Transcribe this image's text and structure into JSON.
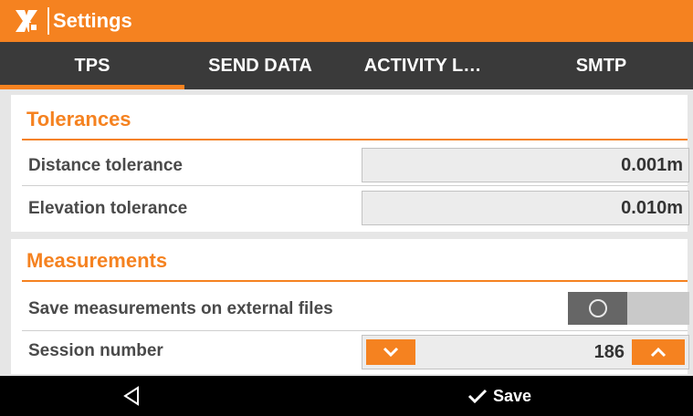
{
  "app": {
    "title": "Settings",
    "icon": "app-logo-icon"
  },
  "tabs": [
    {
      "label": "TPS",
      "active": true
    },
    {
      "label": "SEND DATA",
      "active": false
    },
    {
      "label": "ACTIVITY L…",
      "active": false
    },
    {
      "label": "SMTP",
      "active": false
    }
  ],
  "tolerances": {
    "title": "Tolerances",
    "distance_label": "Distance tolerance",
    "distance_value": "0.001m",
    "elevation_label": "Elevation tolerance",
    "elevation_value": "0.010m"
  },
  "measurements": {
    "title": "Measurements",
    "save_external_label": "Save measurements on external files",
    "save_external_enabled": false,
    "session_label": "Session number",
    "session_value": "186"
  },
  "navbar": {
    "back_icon": "back-triangle-icon",
    "save_label": "Save",
    "save_icon": "checkmark-icon"
  },
  "colors": {
    "accent": "#f58220",
    "tabbar": "#3a3a3a",
    "navbar": "#000000"
  }
}
